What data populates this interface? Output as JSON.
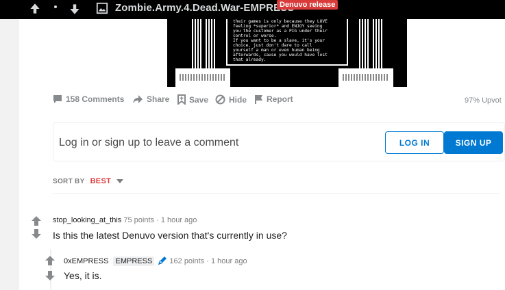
{
  "topbar": {
    "title": "Zombie.Army.4.Dead.War-EMPRESS",
    "flair": "Denuvo release"
  },
  "post_image": {
    "terminal_text": "their games is only because they LOVE\nfeeling *superior* and ENJOY seeing\nyou the customer as a PIG under their\ncontrol or worse.\nIf you want to be a slave, it's your\nchoice, just don't dare to call\nyourself a man or even human being\nafterwards, cause you would have lost\nthat already."
  },
  "actions": {
    "comments": "158 Comments",
    "share": "Share",
    "save": "Save",
    "hide": "Hide",
    "report": "Report",
    "upvoted": "97% Upvot"
  },
  "login": {
    "prompt": "Log in or sign up to leave a comment",
    "login_label": "LOG IN",
    "signup_label": "SIGN UP"
  },
  "sort": {
    "label": "SORT BY",
    "value": "BEST"
  },
  "comments": [
    {
      "author": "stop_looking_at_this",
      "points": "75 points",
      "time": "1 hour ago",
      "body": "Is this the latest Denuvo version that's currently in use?"
    },
    {
      "author": "0xEMPRESS",
      "flair": "EMPRESS",
      "points": "162 points",
      "time": "1 hour ago",
      "body": "Yes, it is."
    }
  ],
  "colors": {
    "accent": "#0079d3",
    "flair": "#d93a3a",
    "muted": "#878a8c"
  }
}
